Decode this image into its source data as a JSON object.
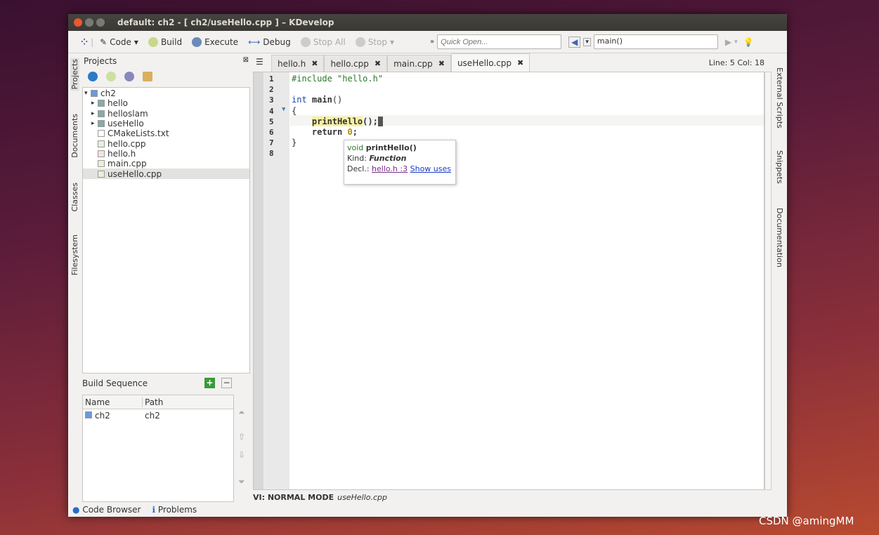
{
  "window": {
    "title": "default:  ch2 - [ ch2/useHello.cpp ] – KDevelop"
  },
  "toolbar": {
    "code": "Code",
    "build": "Build",
    "execute": "Execute",
    "debug": "Debug",
    "stop_all": "Stop All",
    "stop": "Stop",
    "quick_open_placeholder": "Quick Open...",
    "context": "main()"
  },
  "left_tabs": [
    "Projects",
    "Documents",
    "Classes",
    "Filesystem"
  ],
  "right_tabs": [
    "External Scripts",
    "Snippets",
    "Documentation"
  ],
  "projects": {
    "title": "Projects",
    "tree": [
      {
        "label": "ch2",
        "level": 0,
        "arrow": "▾",
        "icon": "project"
      },
      {
        "label": "hello",
        "level": 1,
        "arrow": "▸",
        "icon": "target"
      },
      {
        "label": "helloslam",
        "level": 1,
        "arrow": "▸",
        "icon": "target"
      },
      {
        "label": "useHello",
        "level": 1,
        "arrow": "▸",
        "icon": "target"
      },
      {
        "label": "CMakeLists.txt",
        "level": 1,
        "arrow": "",
        "icon": "file"
      },
      {
        "label": "hello.cpp",
        "level": 1,
        "arrow": "",
        "icon": "cpp"
      },
      {
        "label": "hello.h",
        "level": 1,
        "arrow": "",
        "icon": "h"
      },
      {
        "label": "main.cpp",
        "level": 1,
        "arrow": "",
        "icon": "cpp"
      },
      {
        "label": "useHello.cpp",
        "level": 1,
        "arrow": "",
        "icon": "cpp",
        "selected": true
      }
    ]
  },
  "build_sequence": {
    "title": "Build Sequence",
    "columns": [
      "Name",
      "Path"
    ],
    "rows": [
      {
        "name": "ch2",
        "path": "ch2"
      }
    ]
  },
  "bottom": {
    "code_browser": "Code Browser",
    "problems": "Problems"
  },
  "editor": {
    "tabs": [
      "hello.h",
      "hello.cpp",
      "main.cpp",
      "useHello.cpp"
    ],
    "active_tab": 3,
    "position": "Line: 5 Col: 18",
    "lines": [
      "#include \"hello.h\"",
      "",
      "int main()",
      "{",
      "    printHello();",
      "    return 0;",
      "}",
      ""
    ],
    "line_numbers": [
      "1",
      "2",
      "3",
      "4",
      "5",
      "6",
      "7",
      "8"
    ],
    "tooltip": {
      "type": "void",
      "name": "printHello()",
      "kind_label": "Kind:",
      "kind": "Function",
      "decl_label": "Decl.:",
      "decl_link": "hello.h :3",
      "uses_link": "Show uses"
    },
    "status_mode": "VI: NORMAL MODE",
    "status_file": "useHello.cpp"
  },
  "watermark": "CSDN @amingMM"
}
